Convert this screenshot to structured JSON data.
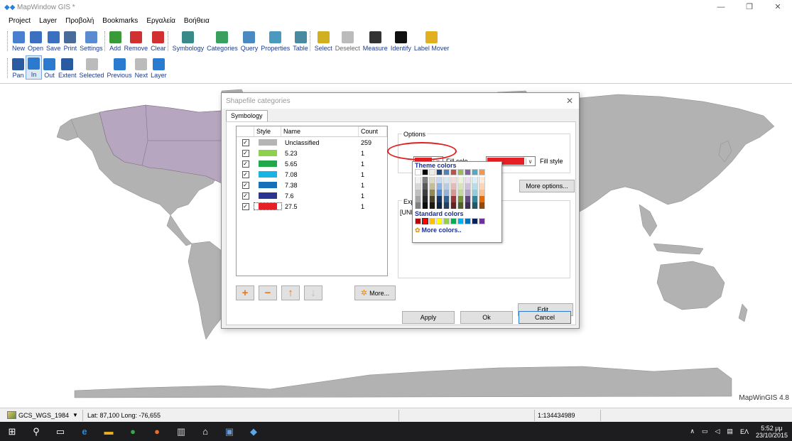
{
  "window": {
    "title": "MapWindow GIS *",
    "minimize": "—",
    "maximize": "❐",
    "close": "✕"
  },
  "menu": [
    "Project",
    "Layer",
    "Προβολή",
    "Bookmarks",
    "Εργαλεία",
    "Βοήθεια"
  ],
  "toolbar_main": [
    {
      "label": "New",
      "icon": "new-file-icon",
      "color": "#4a7fd0"
    },
    {
      "label": "Open",
      "icon": "open-folder-icon",
      "color": "#3b6fc0"
    },
    {
      "label": "Save",
      "icon": "save-icon",
      "color": "#3b6fc0"
    },
    {
      "label": "Print",
      "icon": "printer-icon",
      "color": "#4a6a9a"
    },
    {
      "label": "Settings",
      "icon": "gear-icon",
      "color": "#5a8ad0"
    },
    {
      "label": "Add",
      "icon": "add-layer-icon",
      "color": "#3a9a3a"
    },
    {
      "label": "Remove",
      "icon": "remove-layer-icon",
      "color": "#d03030"
    },
    {
      "label": "Clear",
      "icon": "clear-layers-icon",
      "color": "#d03030"
    },
    {
      "label": "Symbology",
      "icon": "symbology-icon",
      "color": "#3a8a8a"
    },
    {
      "label": "Categories",
      "icon": "categories-icon",
      "color": "#3aa060"
    },
    {
      "label": "Query",
      "icon": "query-icon",
      "color": "#4a8ac0"
    },
    {
      "label": "Properties",
      "icon": "properties-icon",
      "color": "#4a9ac0"
    },
    {
      "label": "Table",
      "icon": "table-icon",
      "color": "#4a8aa0"
    },
    {
      "label": "Select",
      "icon": "select-icon",
      "color": "#d0b020"
    },
    {
      "label": "Deselect",
      "icon": "deselect-icon",
      "color": "#bbbbbb"
    },
    {
      "label": "Measure",
      "icon": "ruler-icon",
      "color": "#333333"
    },
    {
      "label": "Identify",
      "icon": "info-icon",
      "color": "#111111"
    },
    {
      "label": "Label Mover",
      "icon": "label-mover-icon",
      "color": "#e0b020"
    }
  ],
  "toolbar_nav": [
    {
      "label": "Pan",
      "icon": "pan-icon",
      "color": "#2a5aa0"
    },
    {
      "label": "In",
      "icon": "zoom-in-icon",
      "color": "#2a7ad0"
    },
    {
      "label": "Out",
      "icon": "zoom-out-icon",
      "color": "#2a7ad0"
    },
    {
      "label": "Extent",
      "icon": "zoom-extent-icon",
      "color": "#2a5aa0"
    },
    {
      "label": "Selected",
      "icon": "zoom-selected-icon",
      "color": "#bbbbbb"
    },
    {
      "label": "Previous",
      "icon": "zoom-previous-icon",
      "color": "#2a7ad0"
    },
    {
      "label": "Next",
      "icon": "zoom-next-icon",
      "color": "#bbbbbb"
    },
    {
      "label": "Layer",
      "icon": "zoom-layer-icon",
      "color": "#2a7ad0"
    }
  ],
  "map": {
    "version_label": "MapWinGIS 4.8",
    "land_color": "#b2b2b2",
    "highlight_color": "#b6a6bf"
  },
  "dialog": {
    "title": "Shapefile categories",
    "tab": "Symbology",
    "columns": [
      "",
      "Style",
      "Name",
      "Count"
    ],
    "rows": [
      {
        "checked": true,
        "color": "#b5b5b5",
        "name": "Unclassified",
        "count": "259"
      },
      {
        "checked": true,
        "color": "#8fd14f",
        "name": "5.23",
        "count": "1"
      },
      {
        "checked": true,
        "color": "#22a84a",
        "name": "5.65",
        "count": "1"
      },
      {
        "checked": true,
        "color": "#1ab3e6",
        "name": "7.08",
        "count": "1"
      },
      {
        "checked": true,
        "color": "#1670b9",
        "name": "7.38",
        "count": "1"
      },
      {
        "checked": true,
        "color": "#2b3591",
        "name": "7.6",
        "count": "1"
      },
      {
        "checked": true,
        "color": "#e61e25",
        "name": "27.5",
        "count": "1"
      }
    ],
    "more_button": "More...",
    "options_label": "Options",
    "fill_color_label": "Fill colo",
    "fill_style_label": "Fill style",
    "fill_color_value": "#e61e25",
    "more_options": "More options...",
    "expression_label": "Expr",
    "expression_text": "[UNE",
    "edit_button": "Edit...",
    "apply": "Apply",
    "ok": "Ok",
    "cancel": "Cancel"
  },
  "palette": {
    "theme_header": "Theme colors",
    "theme_top": [
      "#ffffff",
      "#000000",
      "#eeece1",
      "#1f497d",
      "#4f81bd",
      "#c0504d",
      "#9bbb59",
      "#8064a2",
      "#4bacc6",
      "#f79646"
    ],
    "shade_columns": [
      [
        "#f2f2f2",
        "#d8d8d8",
        "#bfbfbf",
        "#a5a5a5",
        "#7f7f7f"
      ],
      [
        "#7f7f7f",
        "#595959",
        "#3f3f3f",
        "#262626",
        "#0c0c0c"
      ],
      [
        "#ddd9c3",
        "#c4bd97",
        "#938953",
        "#494429",
        "#1d1b10"
      ],
      [
        "#c6d9f0",
        "#8db3e2",
        "#548dd4",
        "#17365d",
        "#0f243e"
      ],
      [
        "#dbe5f1",
        "#b8cce4",
        "#95b3d7",
        "#366092",
        "#244061"
      ],
      [
        "#f2dcdb",
        "#e5b9b7",
        "#d99694",
        "#953734",
        "#632423"
      ],
      [
        "#ebf1dd",
        "#d7e3bc",
        "#c3d69b",
        "#76923c",
        "#4f6128"
      ],
      [
        "#e5e0ec",
        "#ccc1d9",
        "#b2a2c7",
        "#5f497a",
        "#3f3151"
      ],
      [
        "#dbeef3",
        "#b7dde8",
        "#92cddc",
        "#31859b",
        "#205867"
      ],
      [
        "#fdeada",
        "#fbd5b5",
        "#fac08f",
        "#e36c09",
        "#974806"
      ]
    ],
    "standard_header": "Standard colors",
    "standard": [
      "#c00000",
      "#ff0000",
      "#ffc000",
      "#ffff00",
      "#92d050",
      "#00b050",
      "#00b0f0",
      "#0070c0",
      "#002060",
      "#7030a0"
    ],
    "more_colors": "More colors.."
  },
  "statusbar": {
    "projection": "GCS_WGS_1984",
    "coords": "Lat: 87,100 Long: -76,655",
    "scale": "1:134434989"
  },
  "taskbar": {
    "language": "ΕΛ",
    "time": "5:52 μμ",
    "date": "23/10/2015"
  }
}
